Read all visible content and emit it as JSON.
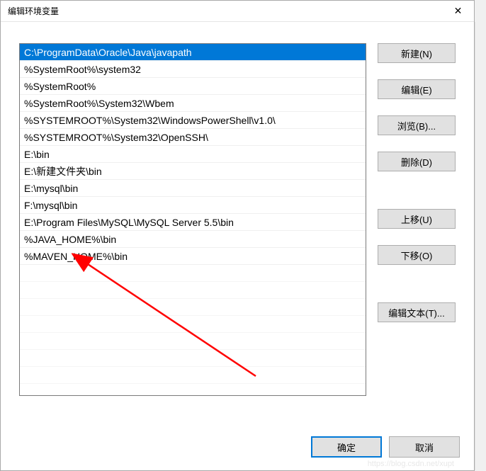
{
  "window": {
    "title": "编辑环境变量",
    "close": "✕"
  },
  "list": {
    "items": [
      "C:\\ProgramData\\Oracle\\Java\\javapath",
      "%SystemRoot%\\system32",
      "%SystemRoot%",
      "%SystemRoot%\\System32\\Wbem",
      "%SYSTEMROOT%\\System32\\WindowsPowerShell\\v1.0\\",
      "%SYSTEMROOT%\\System32\\OpenSSH\\",
      "E:\\bin",
      "E:\\新建文件夹\\bin",
      "E:\\mysql\\bin",
      "F:\\mysql\\bin",
      "E:\\Program Files\\MySQL\\MySQL Server 5.5\\bin",
      "%JAVA_HOME%\\bin",
      "%MAVEN_HOME%\\bin"
    ],
    "selected_index": 0
  },
  "buttons": {
    "new": "新建(N)",
    "edit": "编辑(E)",
    "browse": "浏览(B)...",
    "delete": "删除(D)",
    "moveup": "上移(U)",
    "movedown": "下移(O)",
    "edittext": "编辑文本(T)...",
    "ok": "确定",
    "cancel": "取消"
  },
  "watermark": "https://blog.csdn.net/xupt"
}
